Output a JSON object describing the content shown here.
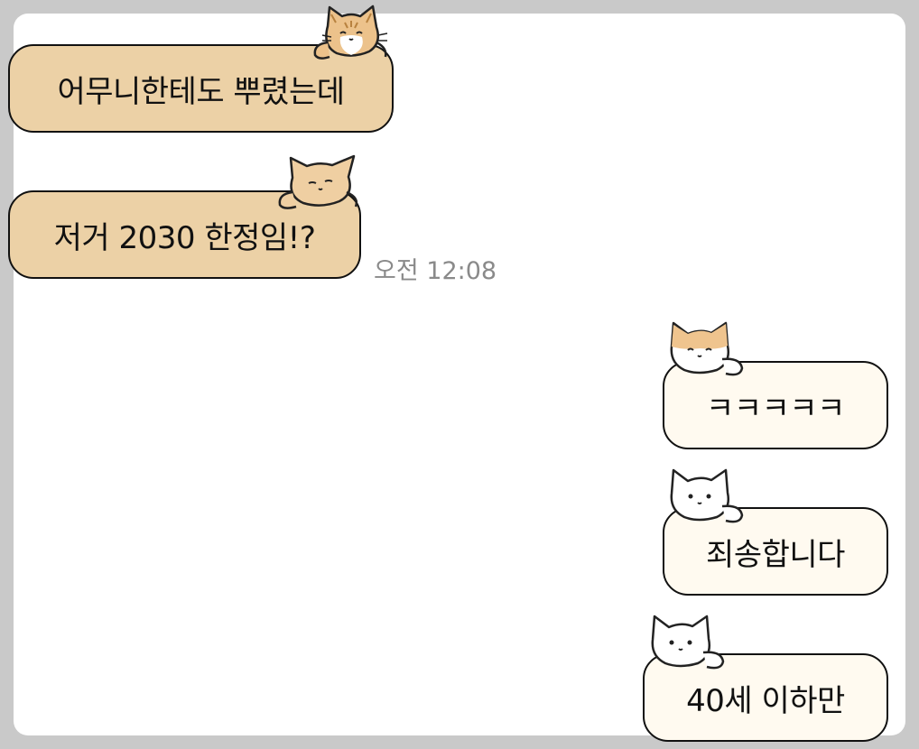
{
  "chat": {
    "messages": [
      {
        "sender": "other",
        "text": "어무니한테도 뿌렸는데",
        "cat": "orange-tabby-cat-icon"
      },
      {
        "sender": "other",
        "text": "저거 2030 한정임!?",
        "cat": "peach-cat-icon"
      },
      {
        "sender": "me",
        "text": "ㅋㅋㅋㅋㅋ",
        "cat": "orange-white-cat-icon"
      },
      {
        "sender": "me",
        "text": "죄송합니다",
        "cat": "white-cat-icon"
      },
      {
        "sender": "me",
        "text": "40세 이하만",
        "cat": "white-cat-icon"
      }
    ],
    "timestamp": "오전 12:08"
  },
  "colors": {
    "received_bubble": "#ecd1a6",
    "sent_bubble": "#fffaf0",
    "bubble_border": "#111111",
    "timestamp_text": "#8a8a8a",
    "background": "#c9c9c9",
    "panel": "#ffffff"
  }
}
